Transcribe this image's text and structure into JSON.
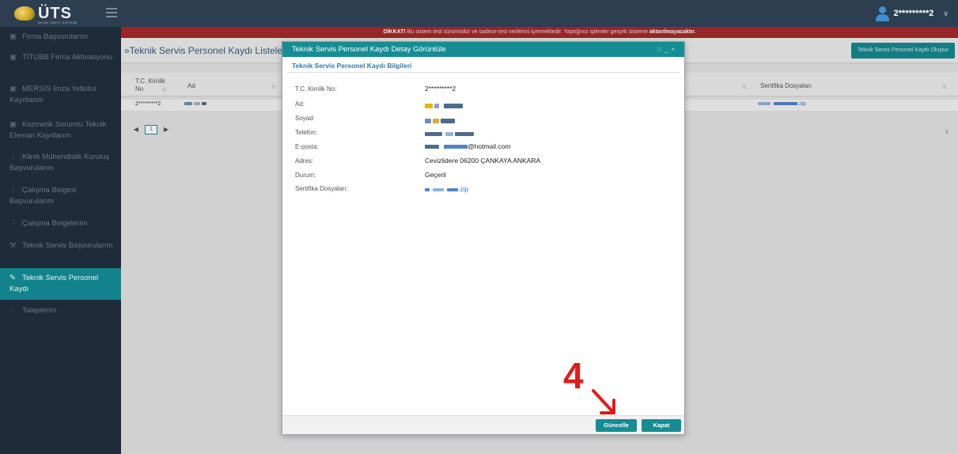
{
  "app": {
    "logo_text": "ÜTS",
    "logo_subtitle": "ÜRÜN TAKİP SİSTEMİ",
    "user_id": "2*********2"
  },
  "sidebar": {
    "items": [
      {
        "label": "Firma Başvurularım",
        "icon": "folder-icon",
        "active": false
      },
      {
        "label": "TİTUBB Firma Aktivasyonu",
        "icon": "folder-icon",
        "active": false
      },
      {
        "label": "MERSİS İmza Yetkilisi Kayıtlarım",
        "icon": "folder-icon",
        "active": false
      },
      {
        "label": "Kozmetik Sorumlu Teknik Eleman Kayıtlarım",
        "icon": "folder-icon",
        "active": false
      },
      {
        "label": "Klinik Mühendislik Kuruluş Başvurularım",
        "icon": "sitemap-icon",
        "active": false
      },
      {
        "label": "Çalışma Belgesi Başvurularım",
        "icon": "sitemap-icon",
        "active": false
      },
      {
        "label": "Çalışma Belgelerim",
        "icon": "sitemap-icon",
        "active": false
      },
      {
        "label": "Teknik Servis Başvurularım",
        "icon": "wrench-icon",
        "active": false
      },
      {
        "label": "Teknik Servis Personel Kaydı",
        "icon": "pencil-icon",
        "active": true
      },
      {
        "label": "Taleplerim",
        "icon": "chat-icon",
        "active": false
      }
    ]
  },
  "warning": {
    "prefix": "DİKKAT!",
    "text": " Bu sistem test sürümüdür ve sadece test verilerini içermektedir. Yaptığınız işlemler gerçek sisteme ",
    "bold": "aktarılmayacaktır."
  },
  "list": {
    "title": "»Teknik Servis Personel Kaydı Listele",
    "create_button": "Teknik Servis Personel Kaydı Oluştur",
    "columns": [
      "T.C. Kimlik No",
      "Ad",
      "Sertifika Dosyaları"
    ],
    "row": {
      "tc": "2*********2",
      "file_suffix": ".zip"
    },
    "page": "1"
  },
  "modal": {
    "title": "Teknik Servis Personel Kaydı Detay Görüntüle",
    "section_title": "Teknik Servis Personel Kaydı Bilgileri",
    "fields": [
      {
        "label": "T.C. Kimlik No:",
        "value": "2*********2"
      },
      {
        "label": "Ad:",
        "value": ""
      },
      {
        "label": "Soyad:",
        "value": ""
      },
      {
        "label": "Telefon:",
        "value": ""
      },
      {
        "label": "E-posta:",
        "value": "@hotmail.com"
      },
      {
        "label": "Adres:",
        "value": "Cevizlidere 06200 ÇANKAYA ANKARA"
      },
      {
        "label": "Durum:",
        "value": "Geçerli"
      },
      {
        "label": "Sertifika Dosyaları:",
        "value": ".zip"
      }
    ],
    "update_button": "Güncelle",
    "close_button": "Kapat"
  },
  "annotation": {
    "step_number": "4",
    "color": "#e01b1b"
  },
  "colors": {
    "topbar": "#2c3e50",
    "sidebar": "#1e2b38",
    "accent": "#168d94",
    "warning": "#a52a2a"
  }
}
